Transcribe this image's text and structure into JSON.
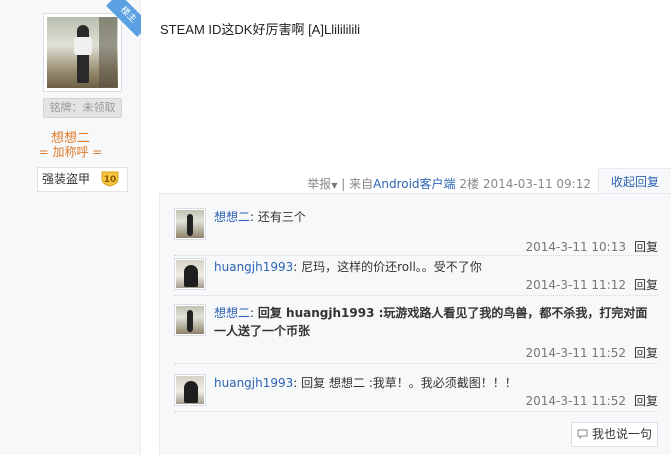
{
  "author": {
    "badge": "楼主",
    "medal": "铭牌：未领取",
    "name": "想想二",
    "add_friend": "= 加称呼 =",
    "level_label": "强装盗甲",
    "level_num": "10"
  },
  "post": {
    "text": "STEAM ID这DK好厉害啊 [A]Llilililili",
    "report": "举报",
    "source_prefix": "| 来自",
    "source_client": "Android客户端",
    "floor": "2楼",
    "datetime": "2014-03-11 09:12",
    "fold_reply": "收起回复"
  },
  "comments": [
    {
      "user": "想想二",
      "sep": ": ",
      "text": "还有三个",
      "bold": false,
      "time": "2014-3-11 10:13",
      "reply": "回复"
    },
    {
      "user": "huangjh1993",
      "sep": ": ",
      "text": "尼玛，这样的价还roll。。受不了你",
      "bold": false,
      "time": "2014-3-11 11:12",
      "reply": "回复"
    },
    {
      "user": "想想二",
      "sep": ": ",
      "text": "回复 huangjh1993 :玩游戏路人看见了我的鸟兽，都不杀我，打完对面一人送了一个币张",
      "bold": true,
      "time": "2014-3-11 11:52",
      "reply": "回复"
    },
    {
      "user": "huangjh1993",
      "sep": ": ",
      "text": "回复 想想二 :我草！。我必须截图！！！",
      "bold": false,
      "time": "2014-3-11 11:52",
      "reply": "回复"
    }
  ],
  "say_button": "我也说一句"
}
